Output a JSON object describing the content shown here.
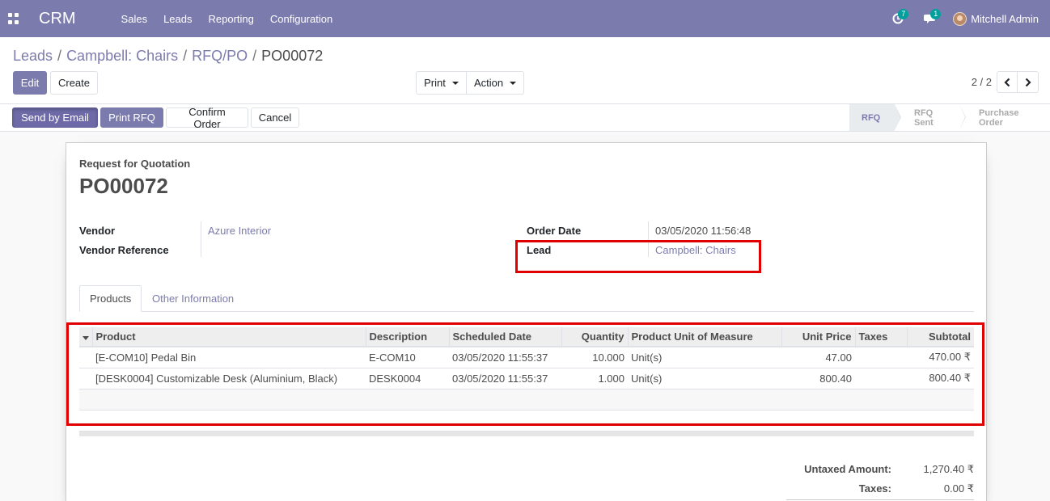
{
  "navbar": {
    "app": "CRM",
    "menu": [
      "Sales",
      "Leads",
      "Reporting",
      "Configuration"
    ],
    "activity_count": "7",
    "message_count": "1",
    "user": "Mitchell Admin"
  },
  "breadcrumb": {
    "items": [
      "Leads",
      "Campbell: Chairs",
      "RFQ/PO"
    ],
    "current": "PO00072"
  },
  "buttons": {
    "edit": "Edit",
    "create": "Create",
    "print": "Print",
    "action": "Action",
    "send_email": "Send by Email",
    "print_rfq": "Print RFQ",
    "confirm": "Confirm Order",
    "cancel": "Cancel"
  },
  "pager": {
    "text": "2 / 2"
  },
  "status": {
    "steps": [
      "RFQ",
      "RFQ Sent",
      "Purchase Order"
    ]
  },
  "form": {
    "doc_type": "Request for Quotation",
    "name": "PO00072",
    "vendor_label": "Vendor",
    "vendor_value": "Azure Interior",
    "vendor_ref_label": "Vendor Reference",
    "order_date_label": "Order Date",
    "order_date_value": "03/05/2020 11:56:48",
    "lead_label": "Lead",
    "lead_value": "Campbell: Chairs"
  },
  "tabs": [
    "Products",
    "Other Information"
  ],
  "lines": {
    "headers": [
      "Product",
      "Description",
      "Scheduled Date",
      "Quantity",
      "Product Unit of Measure",
      "Unit Price",
      "Taxes",
      "Subtotal"
    ],
    "rows": [
      [
        "[E-COM10] Pedal Bin",
        "E-COM10",
        "03/05/2020 11:55:37",
        "10.000",
        "Unit(s)",
        "47.00",
        "",
        "470.00 ₹"
      ],
      [
        "[DESK0004] Customizable Desk (Aluminium, Black)",
        "DESK0004",
        "03/05/2020 11:55:37",
        "1.000",
        "Unit(s)",
        "800.40",
        "",
        "800.40 ₹"
      ]
    ]
  },
  "totals": {
    "untaxed_label": "Untaxed Amount:",
    "untaxed_value": "1,270.40 ₹",
    "taxes_label": "Taxes:",
    "taxes_value": "0.00 ₹"
  },
  "colors": {
    "brand": "#7c7bad",
    "highlight": "#e00000"
  }
}
